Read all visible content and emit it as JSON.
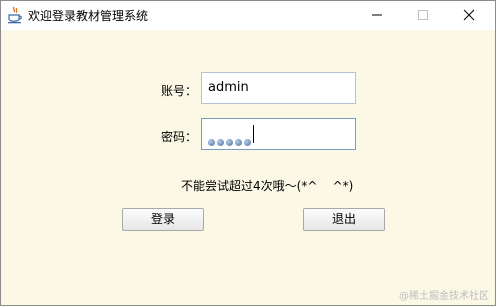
{
  "window": {
    "title": "欢迎登录教材管理系统"
  },
  "titlebar": {
    "icons": [
      "java-cup-icon",
      "minimize-icon",
      "maximize-icon",
      "close-icon"
    ]
  },
  "form": {
    "username_label": "账号：",
    "username_value": "admin",
    "password_label": "密码：",
    "password_masked_count": 5,
    "message": "不能尝试超过4次哦～(*^    ^*)"
  },
  "buttons": {
    "login": "登录",
    "exit": "退出"
  },
  "watermark": "@稀土掘金技术社区",
  "colors": {
    "background": "#fbf8e6",
    "titlebar": "#ffffff",
    "focus_border": "#7a9cc0"
  }
}
